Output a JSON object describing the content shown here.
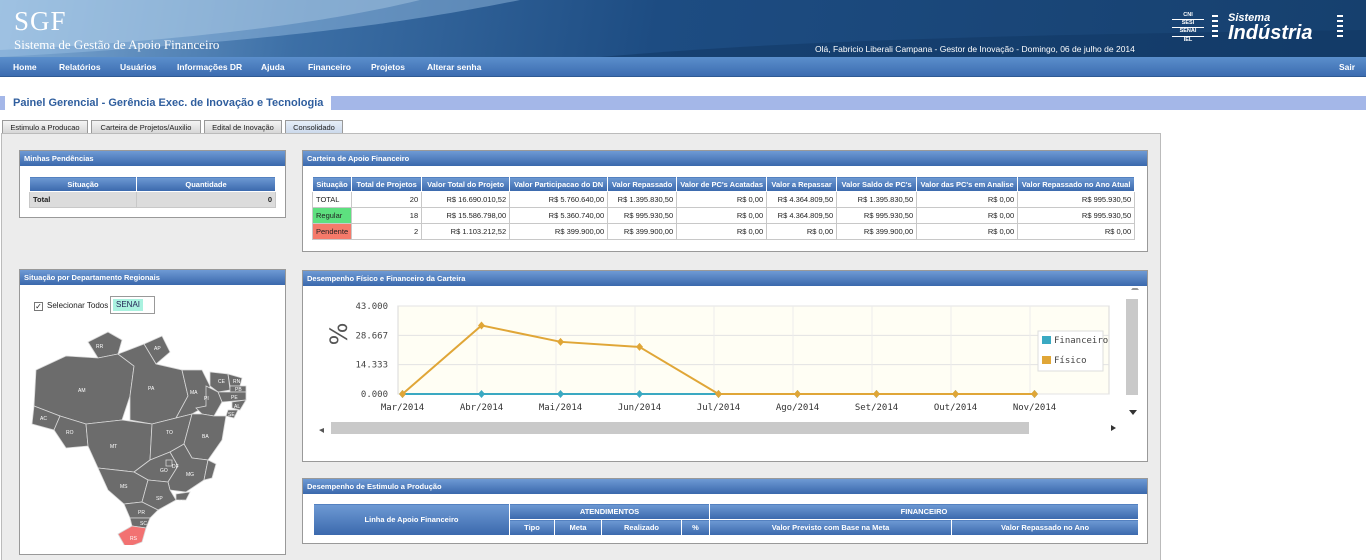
{
  "header": {
    "logo": "SGF",
    "subtitle": "Sistema de Gestão de Apoio Financeiro",
    "greeting": "Olá, Fabricio Liberali Campana - Gestor de Inovação - Domingo, 06 de julho de 2014",
    "brand_stack": [
      "CNI",
      "SESI",
      "SENAI",
      "IEL"
    ],
    "brand_line1": "Sistema",
    "brand_line2": "Indústria"
  },
  "nav": {
    "items": [
      "Home",
      "Relatórios",
      "Usuários",
      "Informações DR",
      "Ajuda",
      "Financeiro",
      "Projetos",
      "Alterar senha"
    ],
    "logout": "Sair"
  },
  "page_title": "Painel Gerencial - Gerência Exec. de Inovação e Tecnologia",
  "tabs": [
    "Estimulo a Producao",
    "Carteira de Projetos/Auxilio",
    "Edital de Inovação",
    "Consolidado"
  ],
  "active_tab": "Consolidado",
  "pendencias": {
    "title": "Minhas Pendências",
    "headers": [
      "Situação",
      "Quantidade"
    ],
    "row": {
      "label": "Total",
      "value": "0"
    }
  },
  "regionais": {
    "title": "Situação por Departamento Regionais",
    "select_all_label": "Selecionar Todos",
    "select_all_checked": true,
    "selected_value": "SENAI",
    "states": [
      "RR",
      "AP",
      "AM",
      "PA",
      "MA",
      "CE",
      "RN",
      "PB",
      "PE",
      "AL",
      "SE",
      "AC",
      "RO",
      "MT",
      "TO",
      "PI",
      "BA",
      "GO",
      "DF",
      "MG",
      "ES",
      "MS",
      "SP",
      "RJ",
      "PR",
      "SC",
      "RS"
    ],
    "highlight_state": "RS",
    "highlight_color": "#f27272",
    "map_color": "#6c6c6c"
  },
  "carteira": {
    "title": "Carteira de Apoio Financeiro",
    "headers": [
      "Situação",
      "Total de Projetos",
      "Valor Total do Projeto",
      "Valor Participacao do DN",
      "Valor Repassado",
      "Valor de PC's Acatadas",
      "Valor a Repassar",
      "Valor Saldo de PC's",
      "Valor das PC's em Analise",
      "Valor Repassado no Ano Atual"
    ],
    "rows": [
      {
        "label": "TOTAL",
        "color": "#ffffff",
        "values": [
          "20",
          "R$ 16.690.010,52",
          "R$ 5.760.640,00",
          "R$ 1.395.830,50",
          "R$ 0,00",
          "R$ 4.364.809,50",
          "R$ 1.395.830,50",
          "R$ 0,00",
          "R$ 995.930,50"
        ]
      },
      {
        "label": "Regular",
        "color": "#5de07f",
        "values": [
          "18",
          "R$ 15.586.798,00",
          "R$ 5.360.740,00",
          "R$ 995.930,50",
          "R$ 0,00",
          "R$ 4.364.809,50",
          "R$ 995.930,50",
          "R$ 0,00",
          "R$ 995.930,50"
        ]
      },
      {
        "label": "Pendente",
        "color": "#f57a6a",
        "values": [
          "2",
          "R$ 1.103.212,52",
          "R$ 399.900,00",
          "R$ 399.900,00",
          "R$ 0,00",
          "R$ 0,00",
          "R$ 399.900,00",
          "R$ 0,00",
          "R$ 0,00"
        ]
      }
    ]
  },
  "desempenho": {
    "title": "Desempenho Físico e Financeiro da Carteira"
  },
  "chart_data": {
    "type": "line",
    "categories": [
      "Mar/2014",
      "Abr/2014",
      "Mai/2014",
      "Jun/2014",
      "Jul/2014",
      "Ago/2014",
      "Set/2014",
      "Out/2014",
      "Nov/2014"
    ],
    "y_ticks": [
      "0.000",
      "14.333",
      "28.667",
      "43.000"
    ],
    "ylim": [
      0,
      43
    ],
    "ylabel": "%",
    "xlabel": "",
    "grid": true,
    "legend_position": "right",
    "series": [
      {
        "name": "Financeiro",
        "color": "#3aa9c2",
        "values": [
          0,
          0,
          0,
          0,
          0,
          0,
          0,
          0,
          0
        ]
      },
      {
        "name": "Físico",
        "color": "#e0a637",
        "values": [
          0,
          33.5,
          25.5,
          23,
          0,
          0,
          0,
          0,
          0
        ]
      }
    ]
  },
  "estimulo": {
    "title": "Desempenho de Estimulo a Produção",
    "col_linha": "Linha de Apoio Financeiro",
    "group_atend": "ATENDIMENTOS",
    "group_fin": "FINANCEIRO",
    "sub_atend": [
      "Tipo",
      "Meta",
      "Realizado",
      "%"
    ],
    "sub_fin": [
      "Valor Previsto com Base na Meta",
      "Valor Repassado no Ano"
    ]
  }
}
